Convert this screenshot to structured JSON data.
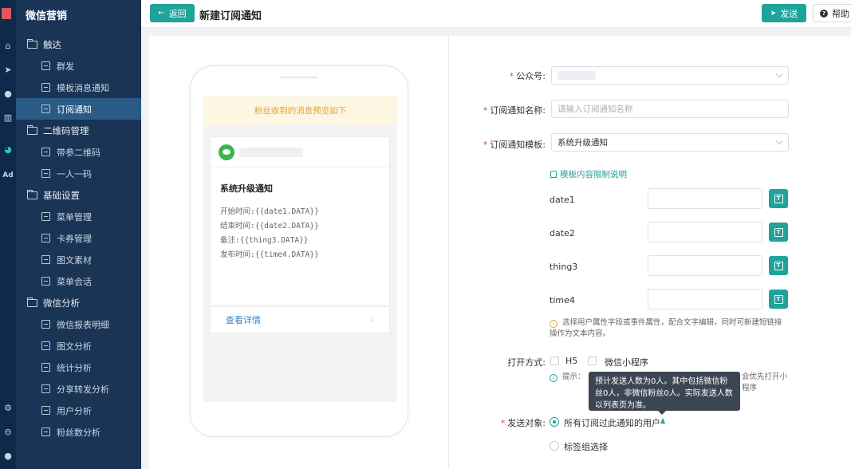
{
  "sidebar": {
    "app_title": "微信营销",
    "groups": [
      {
        "label": "触达",
        "items": [
          "群发",
          "模板消息通知",
          "订阅通知"
        ]
      },
      {
        "label": "二维码管理",
        "items": [
          "带参二维码",
          "一人一码"
        ]
      },
      {
        "label": "基础设置",
        "items": [
          "菜单管理",
          "卡券管理",
          "图文素材",
          "菜单会话"
        ]
      },
      {
        "label": "微信分析",
        "items": [
          "微信报表明细",
          "图文分析",
          "统计分析",
          "分享转发分析",
          "用户分析",
          "粉丝数分析"
        ]
      }
    ],
    "active_item": "订阅通知"
  },
  "rail": {
    "ad_label": "Ad"
  },
  "topbar": {
    "back_label": "返回",
    "title": "新建订阅通知",
    "send_label": "发送",
    "help_label": "帮助"
  },
  "preview": {
    "notice": "粉丝收到的消息预览如下",
    "message_title": "系统升级通知",
    "lines": [
      "开始时间:{{date1.DATA}}",
      "结束时间:{{date2.DATA}}",
      "备注:{{thing3.DATA}}",
      "发布时间:{{time4.DATA}}"
    ],
    "details_link": "查看详情"
  },
  "form": {
    "account_label": "公众号:",
    "name_label": "订阅通知名称:",
    "name_placeholder": "请输入订阅通知名称",
    "template_label": "订阅通知模板:",
    "template_value": "系统升级通知",
    "limit_link": "模板内容限制说明",
    "variables": [
      "date1",
      "date2",
      "thing3",
      "time4"
    ],
    "var_tip": "选择用户属性字段或事件属性，配合文字编辑，同时可新建短链接操作为文本内容。",
    "open_mode_label": "打开方式:",
    "open_options": [
      "H5",
      "微信小程序"
    ],
    "open_tip_prefix": "提示：",
    "open_tip_suffix": "会优先打开小程序",
    "target_label": "发送对象:",
    "target_options": [
      "所有订阅过此通知的用户",
      "标签组选择"
    ],
    "tooltip": "预计发送人数为0人。其中包括微信粉丝0人，非微信粉丝0人。实际发送人数以列表页为准。"
  },
  "colors": {
    "primary": "#1fa39a",
    "sidebar": "#1a3456",
    "rail": "#0e2a4a",
    "required": "#e04b4b",
    "notice": "#e6a23c"
  }
}
